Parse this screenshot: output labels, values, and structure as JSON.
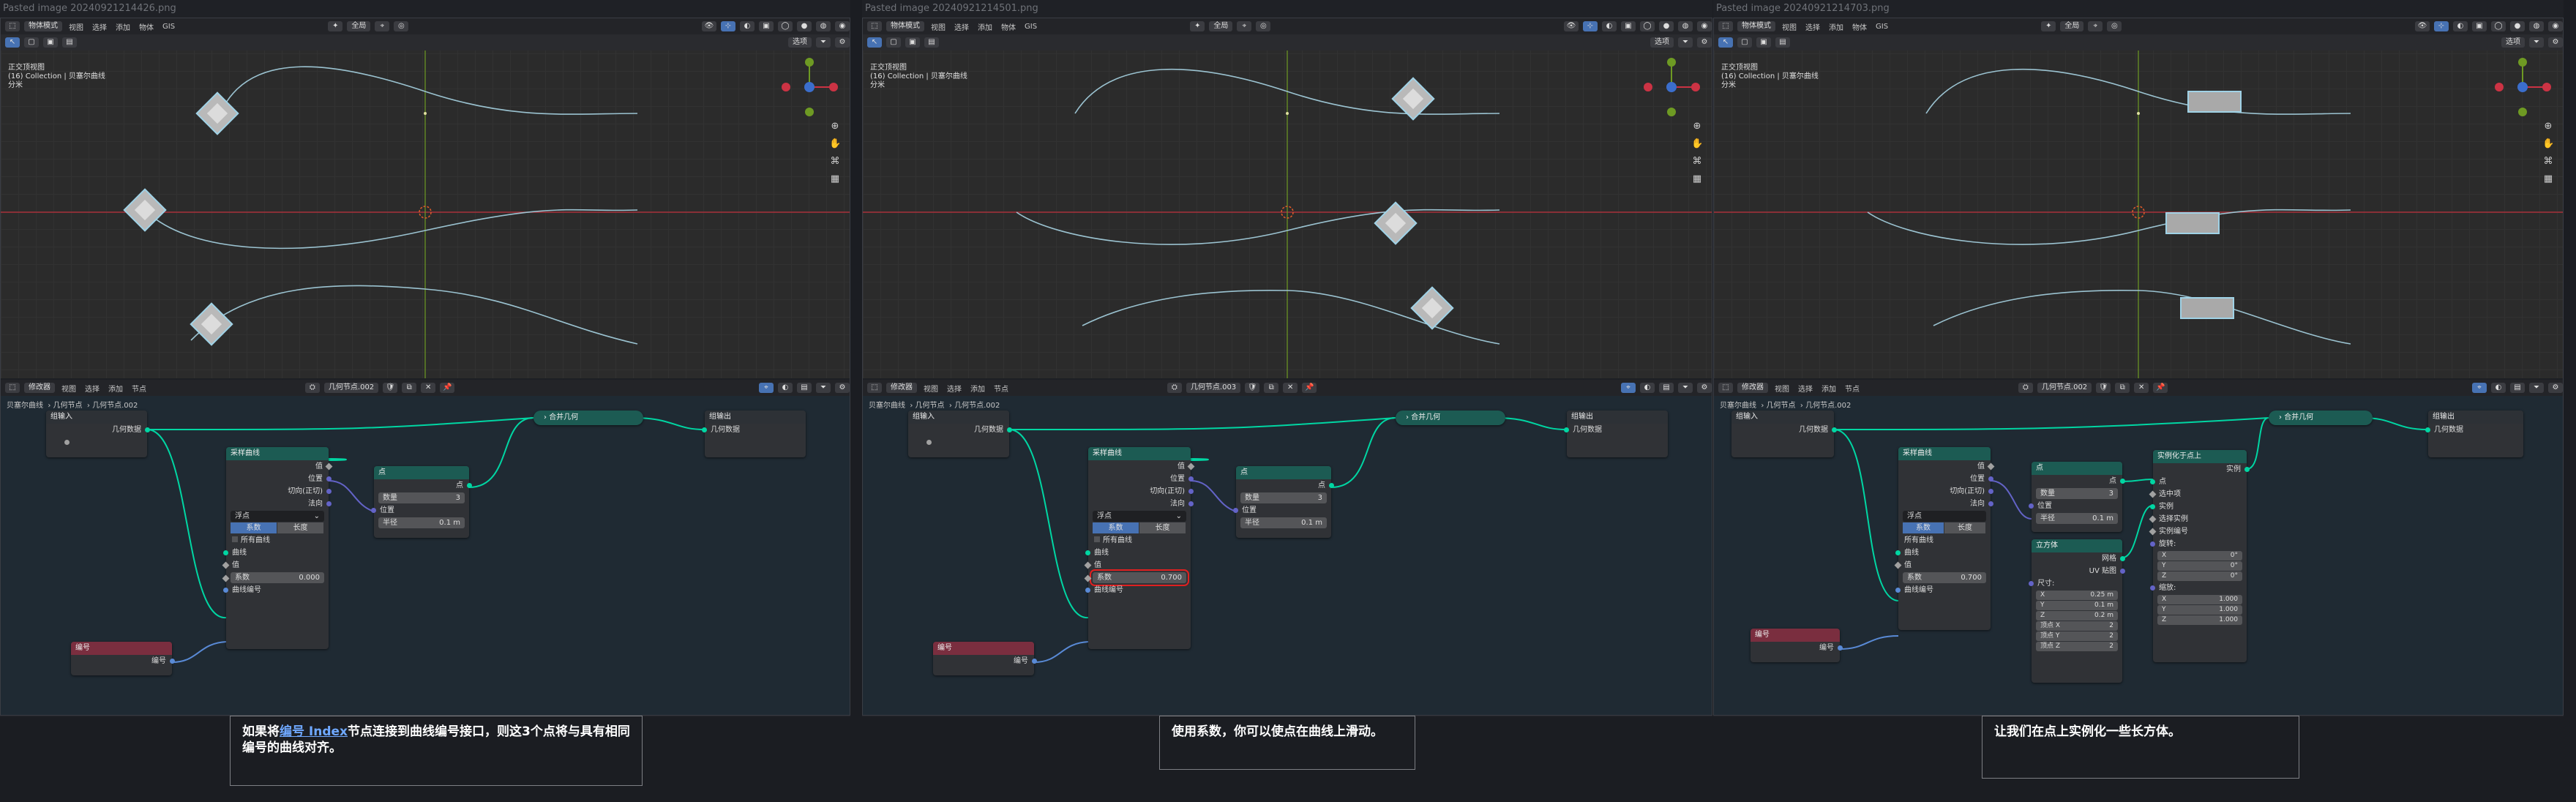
{
  "menu": {
    "object_mode": "物体模式",
    "view": "视图",
    "select": "选择",
    "add": "添加",
    "object": "物体",
    "gis": "GIS",
    "global": "全局",
    "options": "选项"
  },
  "viewport_info": {
    "line1": "正交顶视图",
    "line2": "(16) Collection | 贝塞尔曲线",
    "line3": "分米"
  },
  "node_menu": {
    "editor": "修改器",
    "view": "视图",
    "select": "选择",
    "add": "添加",
    "node": "节点"
  },
  "panels": [
    {
      "title": "Pasted image 20240921214426.png",
      "tree_name": "几何节点.002",
      "breadcrumb": [
        "贝塞尔曲线",
        "几何节点",
        "几何节点.002"
      ],
      "caption_parts": {
        "pre": "如果将",
        "link": "编号 Index",
        "post": "节点连接到曲线编号接口，则这3个点将与具有相同编号的曲线对齐。"
      }
    },
    {
      "title": "Pasted image 20240921214501.png",
      "tree_name": "几何节点.003",
      "breadcrumb": [
        "贝塞尔曲线",
        "几何节点",
        "几何节点.002"
      ],
      "caption_parts": {
        "pre": "使用系数，你可以使点在曲线上滑动。",
        "link": "",
        "post": ""
      }
    },
    {
      "title": "Pasted image 20240921214703.png",
      "tree_name": "几何节点.002",
      "breadcrumb": [
        "贝塞尔曲线",
        "几何节点",
        "几何节点.002"
      ],
      "caption_parts": {
        "pre": "让我们在点上实例化一些长方体。",
        "link": "",
        "post": ""
      }
    }
  ],
  "nodes": {
    "group_input": "组输入",
    "group_output": "组输出",
    "geometry": "几何数据",
    "join_geometry": "合并几何",
    "sample_curve": "采样曲线",
    "value": "值",
    "position": "位置",
    "tangent": "切向(正切)",
    "normal": "法向",
    "mode": "浮点",
    "factor": "系数",
    "length": "长度",
    "all_curves": "所有曲线",
    "curves": "曲线",
    "curve_index": "曲线编号",
    "points": "点",
    "count": "数量",
    "count_val": "3",
    "radius": "半径",
    "radius_val": "0.1 m",
    "index_node": "编号",
    "index": "编号",
    "factor_vals": [
      "0.000",
      "0.700",
      "0.700"
    ],
    "instance_on_points": "实例化于点上",
    "instance": "实例",
    "instances": "实例",
    "selection": "选中项",
    "pick_instance": "选择实例",
    "instance_index": "实例编号",
    "rotation": "旋转:",
    "scale": "缩放:",
    "x": "X",
    "y": "Y",
    "z": "Z",
    "rot_vals": [
      "0°",
      "0°",
      "0°"
    ],
    "scale_vals": [
      "1.000",
      "1.000",
      "1.000"
    ],
    "cube": "立方体",
    "mesh": "网格",
    "uv_map": "UV 贴图",
    "size": "尺寸:",
    "size_vals": [
      "0.25 m",
      "0.1 m",
      "0.2 m"
    ],
    "vert_x": "顶点 X",
    "vert_y": "顶点 Y",
    "vert_z": "顶点 Z",
    "vert_vals": [
      "2",
      "2",
      "2"
    ]
  },
  "colors": {
    "geometry_socket": "#00d6a3",
    "vector_socket": "#6363c7",
    "float_socket": "#a1a1a1",
    "int_socket": "#598ad6",
    "highlight": "#e02020",
    "x_axis": "#a8313a",
    "y_axis": "#6e9a23",
    "curve": "#9bc3d1"
  }
}
